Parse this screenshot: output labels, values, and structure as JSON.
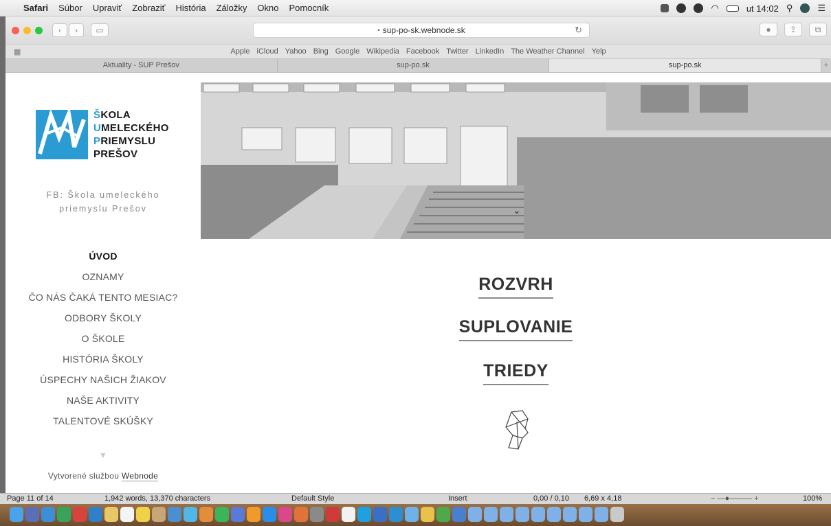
{
  "menubar": {
    "apple_glyph": "",
    "items": [
      "Safari",
      "Súbor",
      "Upraviť",
      "Zobraziť",
      "História",
      "Záložky",
      "Okno",
      "Pomocník"
    ],
    "clock": "ut 14:02"
  },
  "safari": {
    "url": "sup-po-sk.webnode.sk",
    "favorites": [
      "Apple",
      "iCloud",
      "Yahoo",
      "Bing",
      "Google",
      "Wikipedia",
      "Facebook",
      "Twitter",
      "LinkedIn",
      "The Weather Channel",
      "Yelp"
    ],
    "tabs": [
      {
        "label": "Aktuality - SUP Prešov",
        "active": false
      },
      {
        "label": "sup-po.sk",
        "active": false
      },
      {
        "label": "sup-po.sk",
        "active": true
      }
    ]
  },
  "site": {
    "logo_lines": [
      {
        "initial": "Š",
        "rest": "KOLA"
      },
      {
        "initial": "U",
        "rest": "MELECKÉHO"
      },
      {
        "initial": "P",
        "rest": "RIEMYSLU"
      },
      {
        "initial": "",
        "rest": "PREŠOV"
      }
    ],
    "fb_line1": "FB: Škola umeleckého",
    "fb_line2": "priemyslu Prešov",
    "nav": [
      {
        "label": "ÚVOD",
        "active": true
      },
      {
        "label": "OZNAMY",
        "active": false
      },
      {
        "label": "ČO NÁS ČAKÁ TENTO MESIAC?",
        "active": false
      },
      {
        "label": "ODBORY ŠKOLY",
        "active": false
      },
      {
        "label": "O ŠKOLE",
        "active": false
      },
      {
        "label": "HISTÓRIA ŠKOLY",
        "active": false
      },
      {
        "label": "ÚSPECHY NAŠICH ŽIAKOV",
        "active": false
      },
      {
        "label": "NAŠE AKTIVITY",
        "active": false
      },
      {
        "label": "TALENTOVÉ SKÚŠKY",
        "active": false
      }
    ],
    "footer_prefix": "Vytvorené službou",
    "footer_link": "Webnode",
    "buttons": [
      "ROZVRH",
      "SUPLOVANIE",
      "TRIEDY"
    ]
  },
  "word_status": {
    "page": "Page 11 of 14",
    "words": "1,942 words, 13,370 characters",
    "style": "Default Style",
    "mode": "Insert",
    "position": "0,00 / 0,10",
    "size": "6,69 x 4,18",
    "zoom": "100%"
  },
  "colors": {
    "brand_blue": "#2b9bd3",
    "traffic_red": "#fc5f57",
    "traffic_yellow": "#fdbc2e",
    "traffic_green": "#28c840"
  }
}
